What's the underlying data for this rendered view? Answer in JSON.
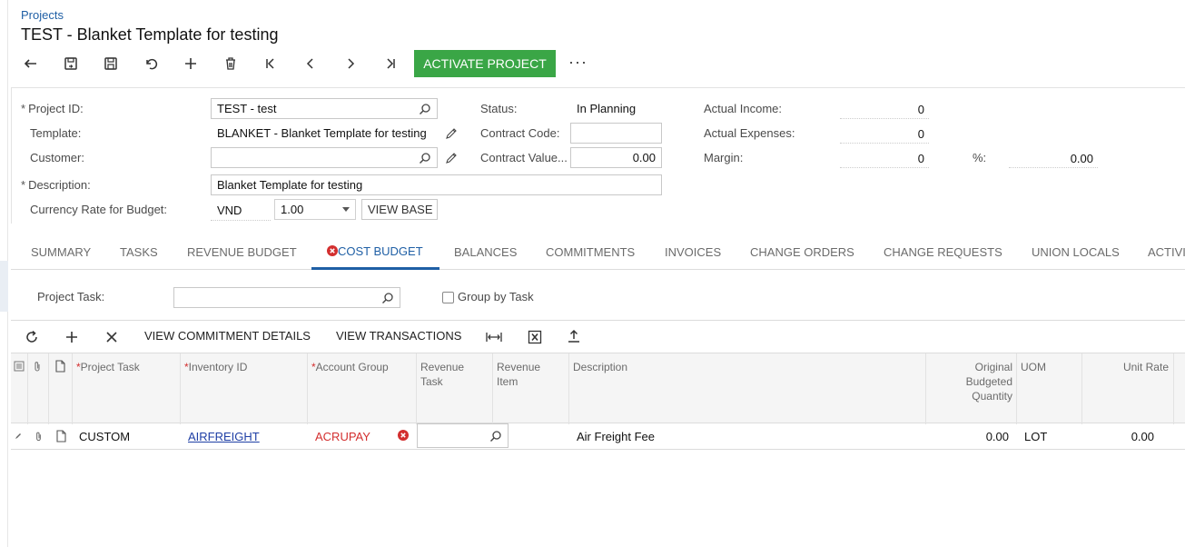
{
  "breadcrumb": "Projects",
  "title": "TEST - Blanket Template for testing",
  "toolbar": {
    "activate_label": "ACTIVATE PROJECT",
    "more_label": "···"
  },
  "form": {
    "project_id": {
      "label": "Project ID:",
      "value": "TEST - test"
    },
    "template": {
      "label": "Template:",
      "value": "BLANKET - Blanket Template for testing"
    },
    "customer": {
      "label": "Customer:",
      "value": ""
    },
    "description": {
      "label": "Description:",
      "value": "Blanket Template for testing"
    },
    "currency_rate": {
      "label": "Currency Rate for Budget:",
      "currency": "VND",
      "rate": "1.00",
      "view_base_label": "VIEW BASE"
    },
    "status": {
      "label": "Status:",
      "value": "In Planning"
    },
    "contract_code": {
      "label": "Contract Code:",
      "value": ""
    },
    "contract_value": {
      "label": "Contract Value...",
      "value": "0.00"
    },
    "actual_income": {
      "label": "Actual Income:",
      "value": "0"
    },
    "actual_expenses": {
      "label": "Actual Expenses:",
      "value": "0"
    },
    "margin": {
      "label": "Margin:",
      "value": "0",
      "pct_label": "%:",
      "pct_value": "0.00"
    }
  },
  "tabs": [
    {
      "label": "SUMMARY"
    },
    {
      "label": "TASKS"
    },
    {
      "label": "REVENUE BUDGET"
    },
    {
      "label": "COST BUDGET"
    },
    {
      "label": "BALANCES"
    },
    {
      "label": "COMMITMENTS"
    },
    {
      "label": "INVOICES"
    },
    {
      "label": "CHANGE ORDERS"
    },
    {
      "label": "CHANGE REQUESTS"
    },
    {
      "label": "UNION LOCALS"
    },
    {
      "label": "ACTIVI"
    }
  ],
  "active_tab": "COST BUDGET",
  "filter": {
    "project_task_label": "Project Task:",
    "project_task_value": "",
    "group_by_task_label": "Group by Task",
    "group_by_task_checked": false
  },
  "grid_toolbar": {
    "view_commitment_details": "VIEW COMMITMENT DETAILS",
    "view_transactions": "VIEW TRANSACTIONS"
  },
  "grid": {
    "columns": {
      "project_task": "Project Task",
      "inventory_id": "Inventory ID",
      "account_group": "Account Group",
      "revenue_task": "Revenue Task",
      "revenue_item": "Revenue Item",
      "description": "Description",
      "original_budgeted_quantity": "Original Budgeted Quantity",
      "uom": "UOM",
      "unit_rate": "Unit Rate"
    },
    "rows": [
      {
        "project_task": "CUSTOM",
        "inventory_id": "AIRFREIGHT",
        "account_group": "ACRUPAY",
        "revenue_task": "",
        "revenue_item": "",
        "description": "Air Freight Fee",
        "original_budgeted_quantity": "0.00",
        "uom": "LOT",
        "unit_rate": "0.00"
      }
    ]
  },
  "colors": {
    "accent": "#1f5fa5",
    "activate": "#3aa646",
    "error": "#d32f2f"
  }
}
